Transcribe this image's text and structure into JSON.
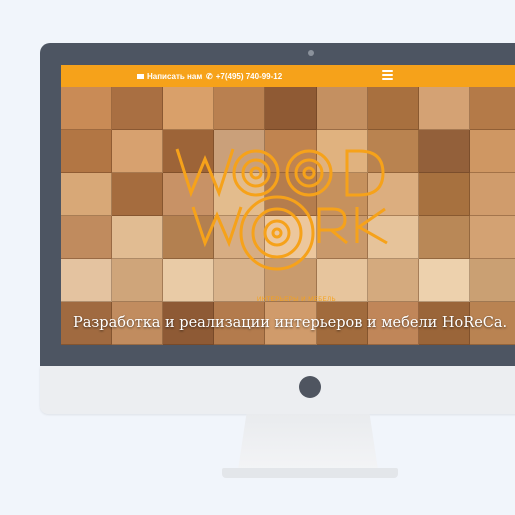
{
  "header": {
    "email_label": "Написать нам",
    "phone": "+7(495) 740-99-12",
    "accent_color": "#f6a21a"
  },
  "hero": {
    "logo_line1": "WOOD",
    "logo_line2": "WORK",
    "small_caption": "ИНТЕРЬЕРЫ И МЕБЕЛЬ",
    "headline": "Разработка и реализации интерьеров и мебели HoReCa."
  },
  "icons": {
    "envelope": "envelope-icon",
    "phone": "phone-icon",
    "menu": "hamburger-menu-icon"
  }
}
